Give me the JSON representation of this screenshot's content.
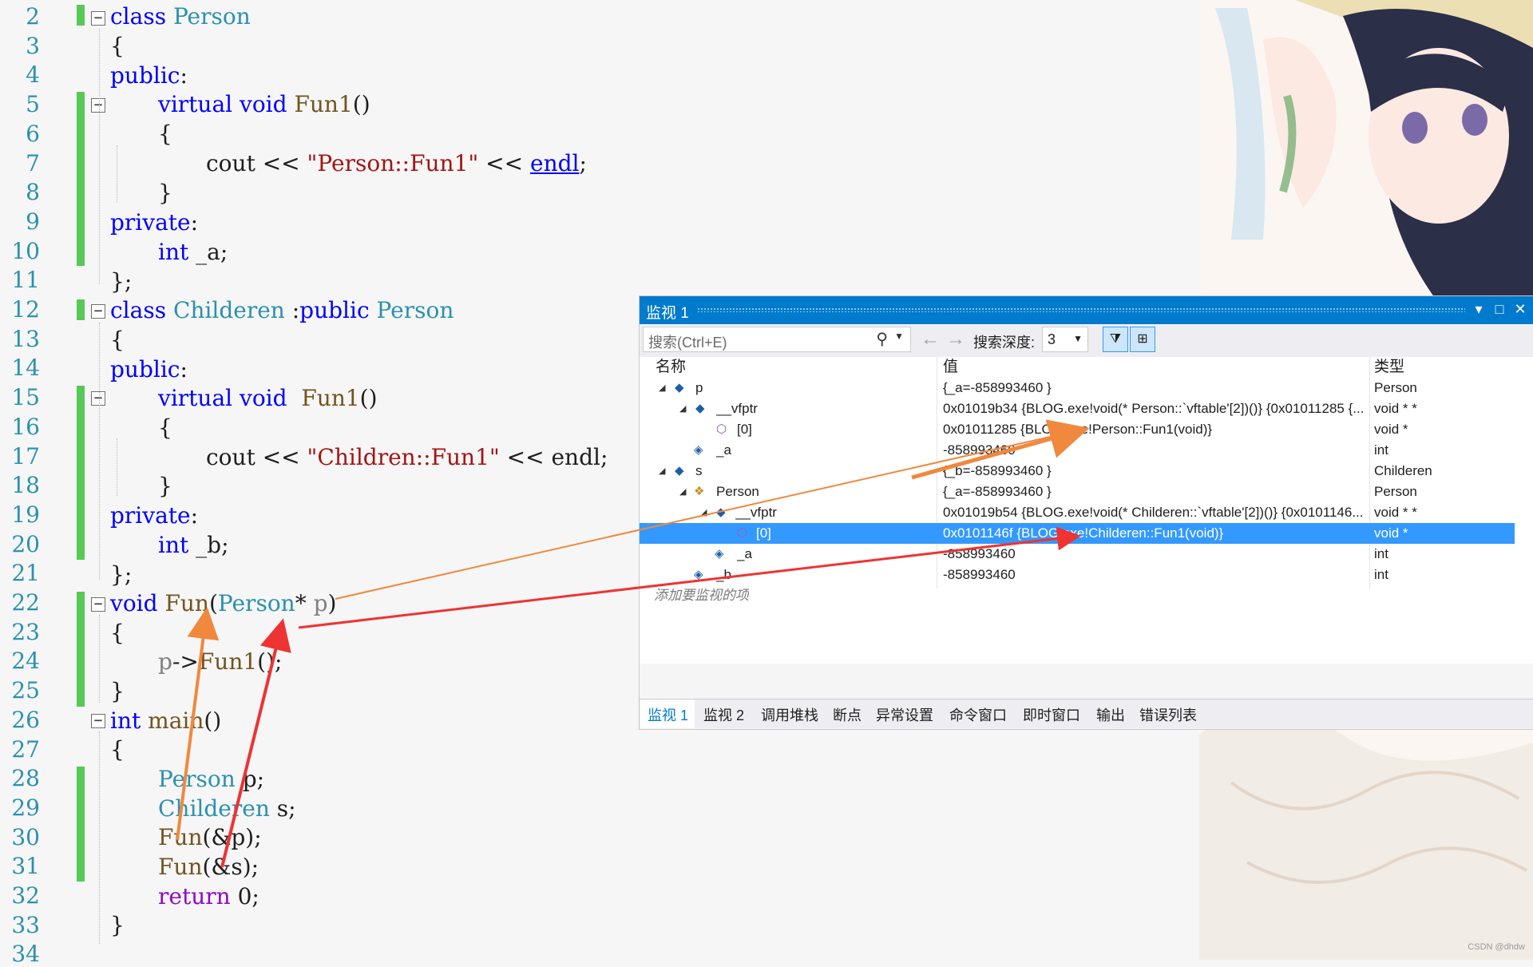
{
  "editor": {
    "line_numbers": [
      "2",
      "3",
      "4",
      "5",
      "6",
      "7",
      "8",
      "9",
      "10",
      "11",
      "12",
      "13",
      "14",
      "15",
      "16",
      "17",
      "18",
      "19",
      "20",
      "21",
      "22",
      "23",
      "24",
      "25",
      "26",
      "27",
      "28",
      "29",
      "30",
      "31",
      "32",
      "33",
      "34"
    ],
    "lines": {
      "l2": {
        "a": "class",
        "b": " Person"
      },
      "l3": {
        "a": "{"
      },
      "l4": {
        "a": "public",
        ":": ":"
      },
      "l5": {
        "a": "virtual",
        "b": " void",
        "c": " Fun1",
        "d": "()"
      },
      "l6": {
        "a": "{"
      },
      "l7": {
        "a": "cout << ",
        "b": "\"Person::Fun1\"",
        "c": " << ",
        "d": "endl",
        "e": ";"
      },
      "l8": {
        "a": "}"
      },
      "l9": {
        "a": "private",
        ":": ":"
      },
      "l10": {
        "a": "int",
        "b": " _a;"
      },
      "l11": {
        "a": "};"
      },
      "l12": {
        "a": "class",
        "b": " Childeren",
        "c": " :",
        "d": "public",
        "e": " Person"
      },
      "l13": {
        "a": "{"
      },
      "l14": {
        "a": "public",
        ":": ":"
      },
      "l15": {
        "a": "virtual",
        "b": " void",
        "c": "  Fun1",
        "d": "()"
      },
      "l16": {
        "a": "{"
      },
      "l17": {
        "a": "cout << ",
        "b": "\"Children::Fun1\"",
        "c": " << endl;"
      },
      "l18": {
        "a": "}"
      },
      "l19": {
        "a": "private",
        ":": ":"
      },
      "l20": {
        "a": "int",
        "b": " _b;"
      },
      "l21": {
        "a": "};"
      },
      "l22": {
        "a": "void",
        "b": " Fun",
        "c": "(",
        "d": "Person",
        "e": "* ",
        "f": "p",
        ")": ")"
      },
      "l23": {
        "a": "{"
      },
      "l24": {
        "a": "p",
        "b": "->",
        "c": "Fun1",
        "d": "();"
      },
      "l25": {
        "a": "}"
      },
      "l26": {
        "a": "int",
        "b": " main",
        "c": "()"
      },
      "l27": {
        "a": "{"
      },
      "l28": {
        "a": "Person",
        "b": " p;"
      },
      "l29": {
        "a": "Childeren",
        "b": " s;"
      },
      "l30": {
        "a": "Fun",
        "b": "(&p);"
      },
      "l31": {
        "a": "Fun",
        "b": "(&s);"
      },
      "l32": {
        "a": "return",
        "b": " 0;"
      },
      "l33": {
        "a": "}"
      }
    }
  },
  "watch": {
    "title": "监视 1",
    "search_placeholder": "搜索(Ctrl+E)",
    "depth_label": "搜索深度:",
    "depth_value": "3",
    "columns": {
      "name": "名称",
      "value": "值",
      "type": "类型"
    },
    "rows": [
      {
        "name": "p",
        "value": "{_a=-858993460 }",
        "type": "Person"
      },
      {
        "name": "__vfptr",
        "value": "0x01019b34 {BLOG.exe!void(* Person::`vftable'[2])()} {0x01011285 {...",
        "type": "void * *"
      },
      {
        "name": "[0]",
        "value": "0x01011285 {BLOG.exe!Person::Fun1(void)}",
        "type": "void *"
      },
      {
        "name": "_a",
        "value": "-858993460",
        "type": "int"
      },
      {
        "name": "s",
        "value": "{_b=-858993460 }",
        "type": "Childeren"
      },
      {
        "name": "Person",
        "value": "{_a=-858993460 }",
        "type": "Person"
      },
      {
        "name": "__vfptr",
        "value": "0x01019b54 {BLOG.exe!void(* Childeren::`vftable'[2])()} {0x0101146...",
        "type": "void * *"
      },
      {
        "name": "[0]",
        "value": "0x0101146f {BLOG.exe!Childeren::Fun1(void)}",
        "type": "void *"
      },
      {
        "name": "_a",
        "value": "-858993460",
        "type": "int"
      },
      {
        "name": "_b",
        "value": "-858993460",
        "type": "int"
      }
    ],
    "add_item_hint": "添加要监视的项",
    "tabs": [
      "监视 1",
      "监视 2",
      "调用堆栈",
      "断点",
      "异常设置",
      "命令窗口",
      "即时窗口",
      "输出",
      "错误列表"
    ]
  },
  "watermark": "CSDN @dhdw",
  "colors": {
    "accent": "#007acc",
    "selection": "#3399ff",
    "arrow_orange": "#f0883e",
    "arrow_red": "#ee3333",
    "change_bar": "#57c957"
  }
}
